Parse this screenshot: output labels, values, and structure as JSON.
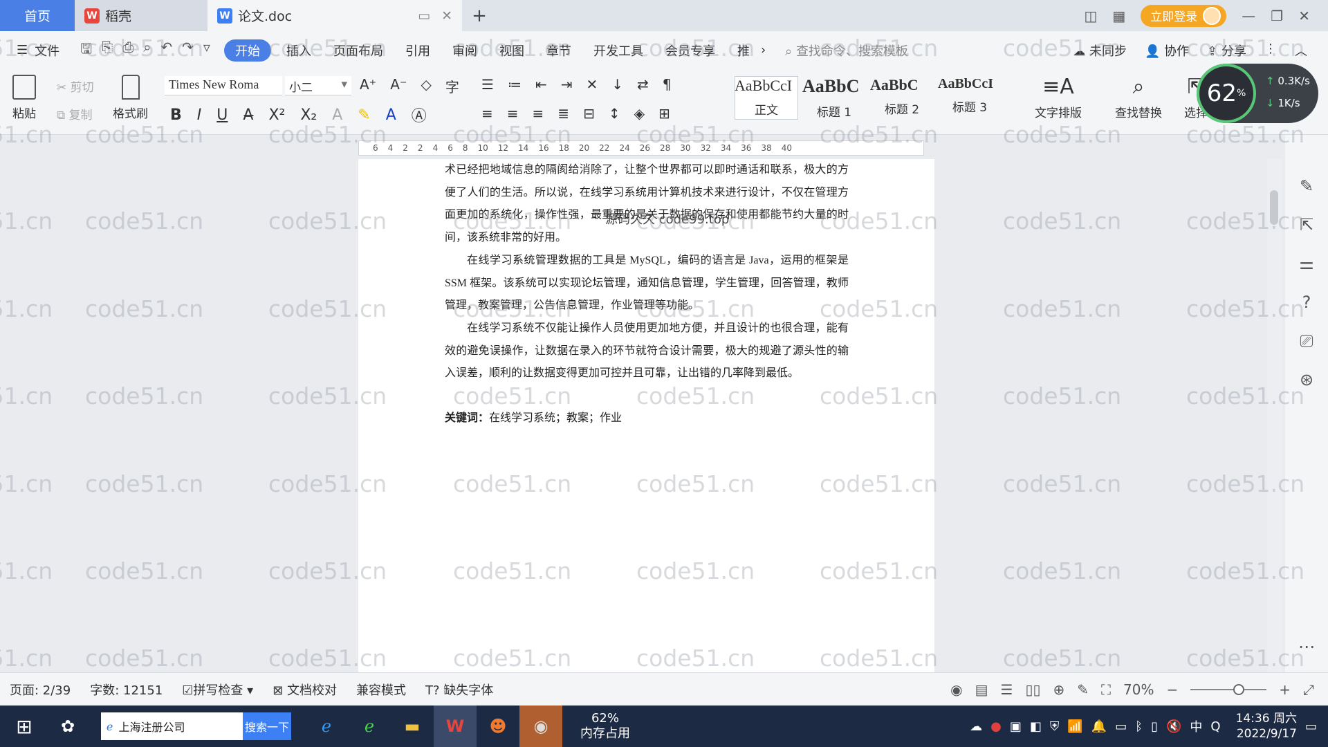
{
  "tabs": {
    "home": "首页",
    "daoke": "稻壳",
    "doc": "论文.doc",
    "login": "立即登录"
  },
  "menu": {
    "file": "文件",
    "items": [
      "开始",
      "插入",
      "页面布局",
      "引用",
      "审阅",
      "视图",
      "章节",
      "开发工具",
      "会员专享",
      "推"
    ],
    "search_cmd": "查找命令、搜索模板",
    "right": [
      "未同步",
      "协作",
      "分享"
    ]
  },
  "ribbon": {
    "paste": "粘贴",
    "cut": "剪切",
    "copy": "复制",
    "format_painter": "格式刷",
    "font_name": "Times New Roma",
    "font_size": "小二",
    "styles": [
      {
        "sample": "AaBbCcI",
        "label": "正文"
      },
      {
        "sample": "AaBbC",
        "label": "标题 1"
      },
      {
        "sample": "AaBbC",
        "label": "标题 2"
      },
      {
        "sample": "AaBbCcI",
        "label": "标题 3"
      }
    ],
    "text_layout": "文字排版",
    "find_replace": "查找替换",
    "select": "选择"
  },
  "speed": {
    "percent": "62",
    "percent_unit": "%",
    "up": "0.3K/s",
    "down": "1K/s"
  },
  "ruler_ticks": [
    "6",
    "4",
    "2",
    "2",
    "4",
    "6",
    "8",
    "10",
    "12",
    "14",
    "16",
    "18",
    "20",
    "22",
    "24",
    "26",
    "28",
    "30",
    "32",
    "34",
    "36",
    "38",
    "40"
  ],
  "doc": {
    "para1": "术已经把地域信息的隔阂给消除了，让整个世界都可以即时通话和联系，极大的方便了人们的生活。所以说，在线学习系统用计算机技术来进行设计，不仅在管理方面更加的系统化，操作性强，最重要的是关于数据的保存和使用都能节约大量的时间，该系统非常的好用。",
    "para2": "在线学习系统管理数据的工具是 MySQL，编码的语言是 Java，运用的框架是 SSM 框架。该系统可以实现论坛管理，通知信息管理，学生管理，回答管理，教师管理，教案管理，公告信息管理，作业管理等功能。",
    "para3": "在线学习系统不仅能让操作人员使用更加地方便，并且设计的也很合理，能有效的避免误操作，让数据在录入的环节就符合设计需要，极大的规避了源头性的输入误差，顺利的让数据变得更加可控并且可靠，让出错的几率降到最低。",
    "keywords_label": "关键词：",
    "keywords": "在线学习系统；教案；作业",
    "overlay": "源码久久 code99.top"
  },
  "watermark": "code51.cn",
  "status": {
    "page": "页面: 2/39",
    "words": "字数: 12151",
    "spell": "拼写检查",
    "proof": "文档校对",
    "compat": "兼容模式",
    "missing_font": "缺失字体",
    "zoom": "70%"
  },
  "taskbar": {
    "search_text": "上海注册公司",
    "search_btn": "搜索一下",
    "mem_percent": "62%",
    "mem_label": "内存占用",
    "time": "14:36 周六",
    "date": "2022/9/17",
    "ime": "中"
  }
}
